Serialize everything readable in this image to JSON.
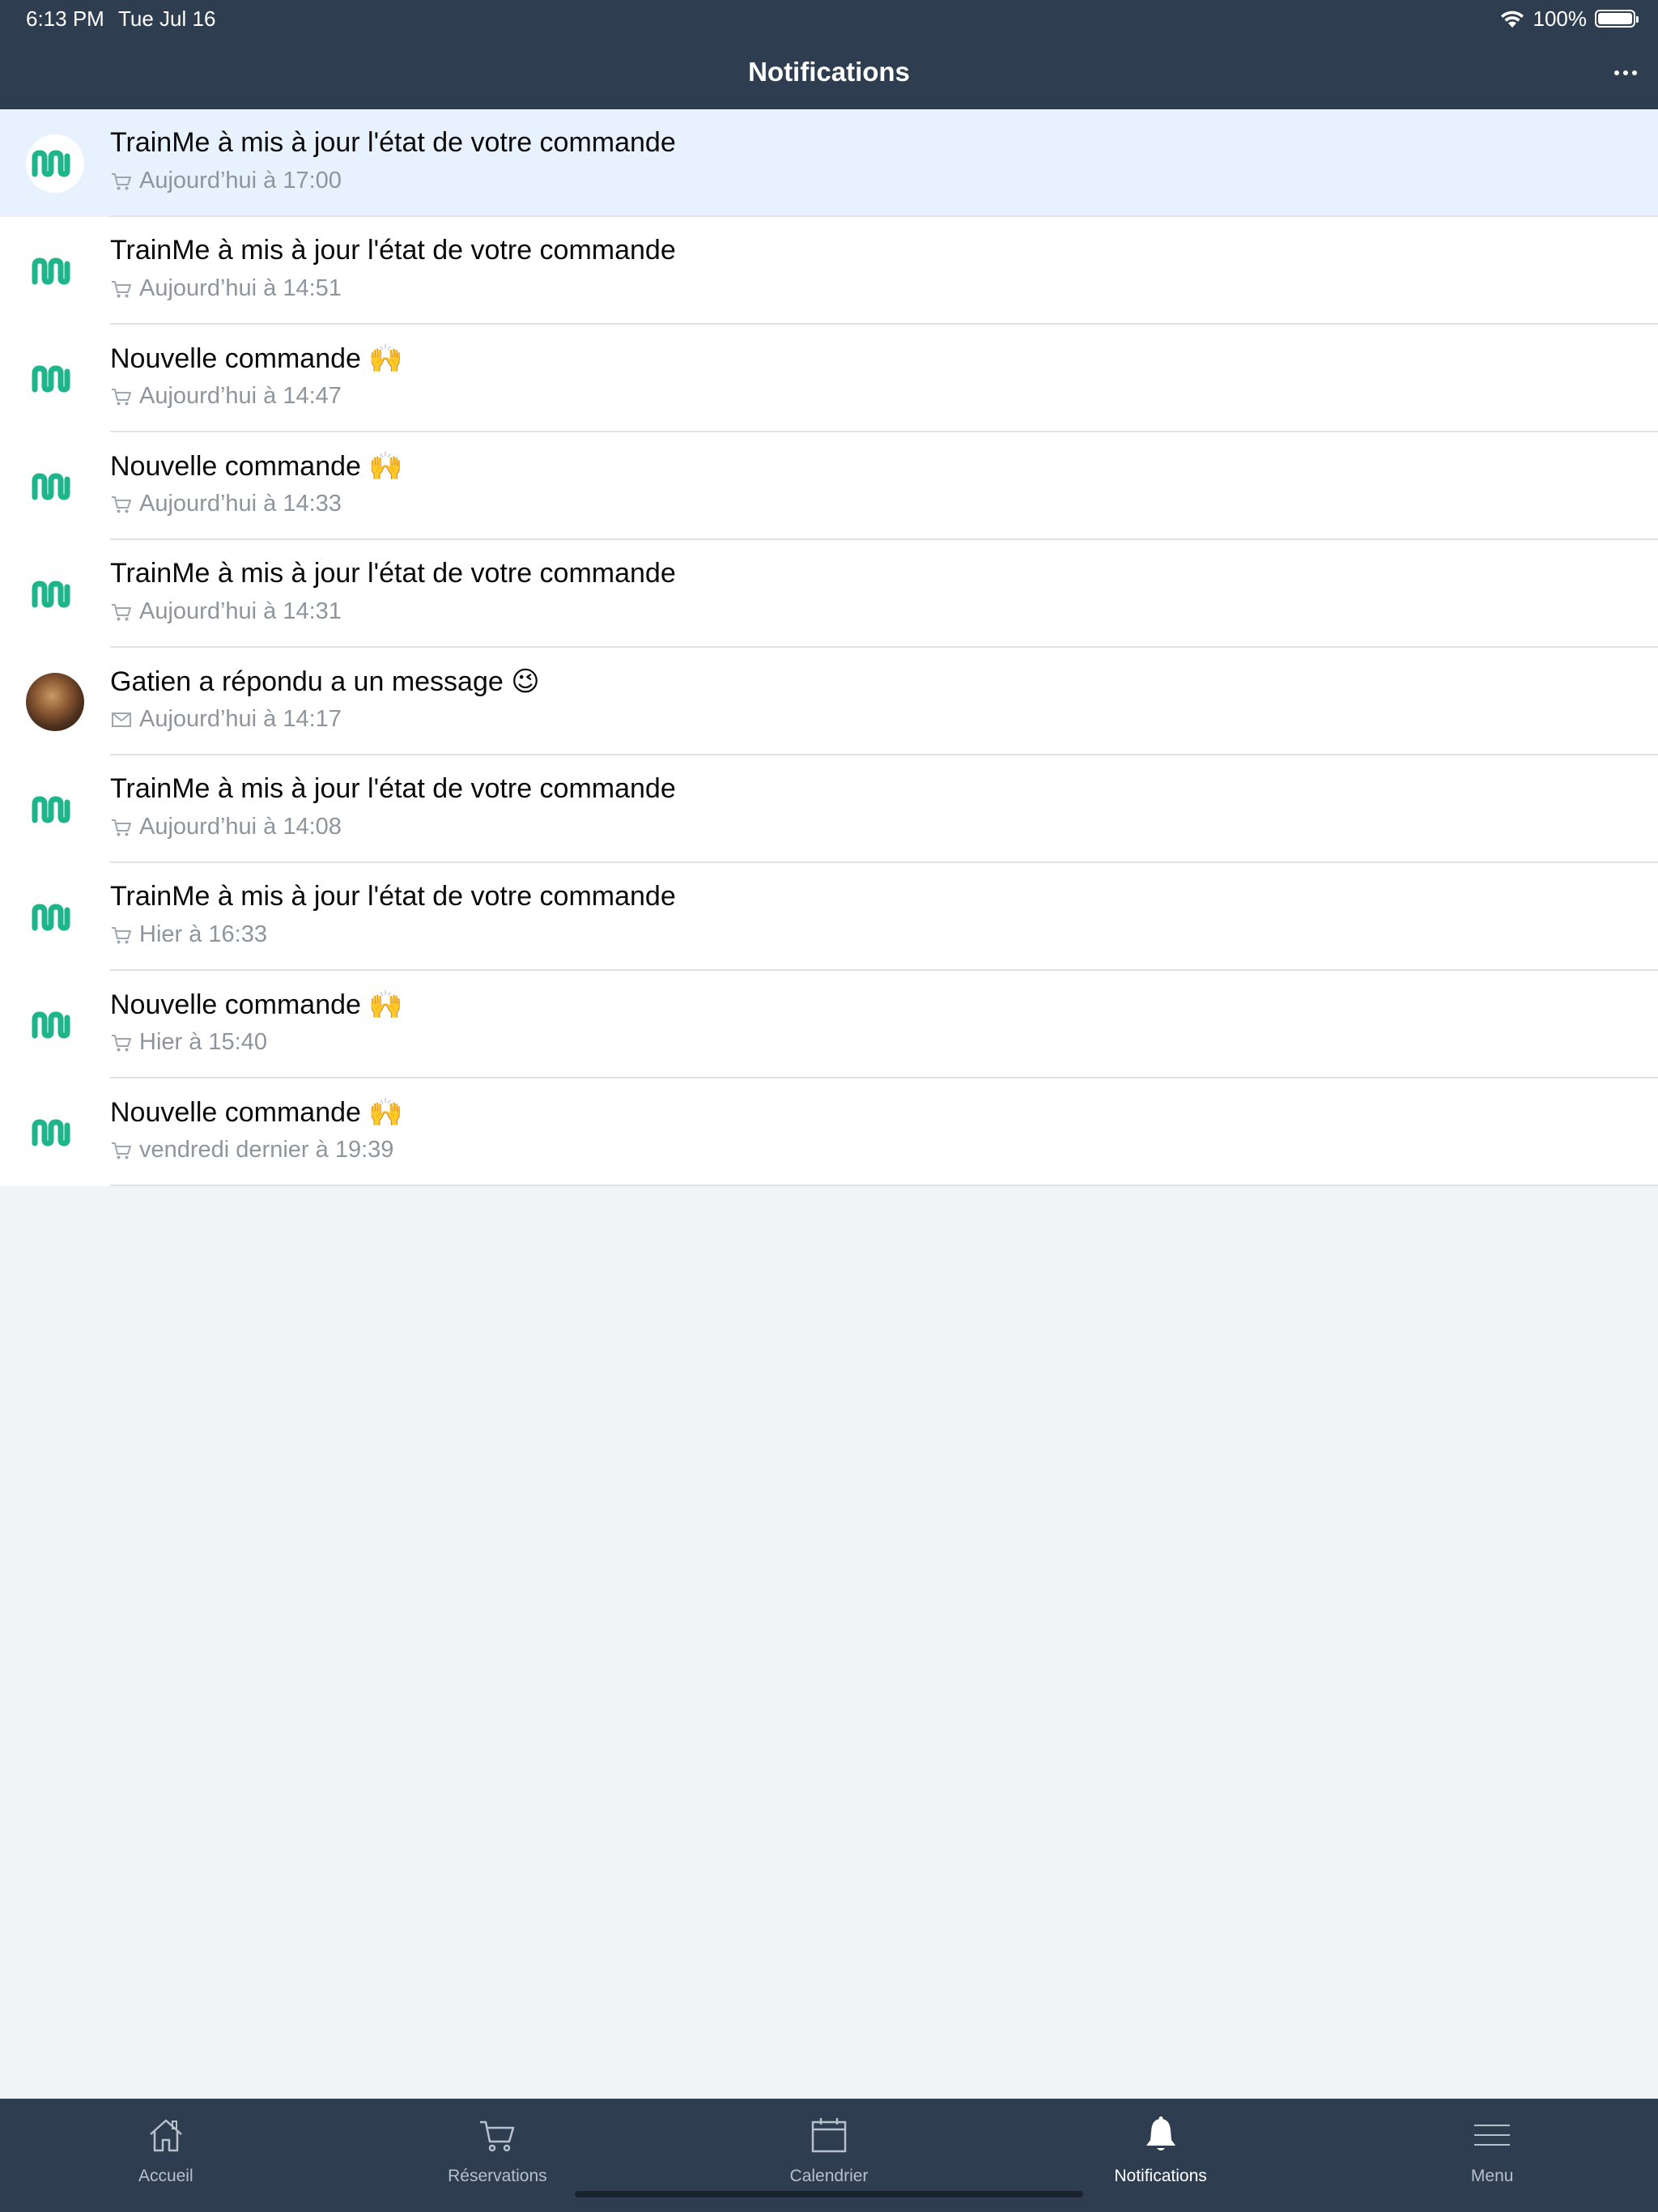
{
  "status_bar": {
    "time": "6:13 PM",
    "date": "Tue Jul 16",
    "battery": "100%"
  },
  "header": {
    "title": "Notifications",
    "more_icon": "ellipsis-icon"
  },
  "notifications": [
    {
      "title": "TrainMe à mis à jour l'état de votre commande",
      "time": "Aujourd’hui à 17:00",
      "avatar": "trainme-logo",
      "type_icon": "cart-icon",
      "highlighted": true
    },
    {
      "title": "TrainMe à mis à jour l'état de votre commande",
      "time": "Aujourd’hui à 14:51",
      "avatar": "trainme-logo",
      "type_icon": "cart-icon"
    },
    {
      "title": "Nouvelle commande 🙌",
      "time": "Aujourd’hui à 14:47",
      "avatar": "trainme-logo",
      "type_icon": "cart-icon"
    },
    {
      "title": "Nouvelle commande 🙌",
      "time": "Aujourd’hui à 14:33",
      "avatar": "trainme-logo",
      "type_icon": "cart-icon"
    },
    {
      "title": "TrainMe à mis à jour l'état de votre commande",
      "time": "Aujourd’hui à 14:31",
      "avatar": "trainme-logo",
      "type_icon": "cart-icon"
    },
    {
      "title": "Gatien a répondu a un message 😉",
      "time": "Aujourd’hui à 14:17",
      "avatar": "user-photo",
      "type_icon": "envelope-icon"
    },
    {
      "title": "TrainMe à mis à jour l'état de votre commande",
      "time": "Aujourd’hui à 14:08",
      "avatar": "trainme-logo",
      "type_icon": "cart-icon"
    },
    {
      "title": "TrainMe à mis à jour l'état de votre commande",
      "time": "Hier à 16:33",
      "avatar": "trainme-logo",
      "type_icon": "cart-icon"
    },
    {
      "title": "Nouvelle commande 🙌",
      "time": "Hier à 15:40",
      "avatar": "trainme-logo",
      "type_icon": "cart-icon"
    },
    {
      "title": "Nouvelle commande 🙌",
      "time": "vendredi dernier à 19:39",
      "avatar": "trainme-logo",
      "type_icon": "cart-icon"
    }
  ],
  "tabbar": {
    "items": [
      {
        "label": "Accueil",
        "icon": "home-icon",
        "active": false
      },
      {
        "label": "Réservations",
        "icon": "cart-icon",
        "active": false
      },
      {
        "label": "Calendrier",
        "icon": "calendar-icon",
        "active": false
      },
      {
        "label": "Notifications",
        "icon": "bell-icon",
        "active": true
      },
      {
        "label": "Menu",
        "icon": "hamburger-icon",
        "active": false
      }
    ]
  },
  "colors": {
    "header_bg": "#2e3d50",
    "brand_green": "#1fb58a",
    "highlight_bg": "#e8f1fe",
    "background": "#f1f3f5",
    "meta_text": "#8e959c"
  }
}
